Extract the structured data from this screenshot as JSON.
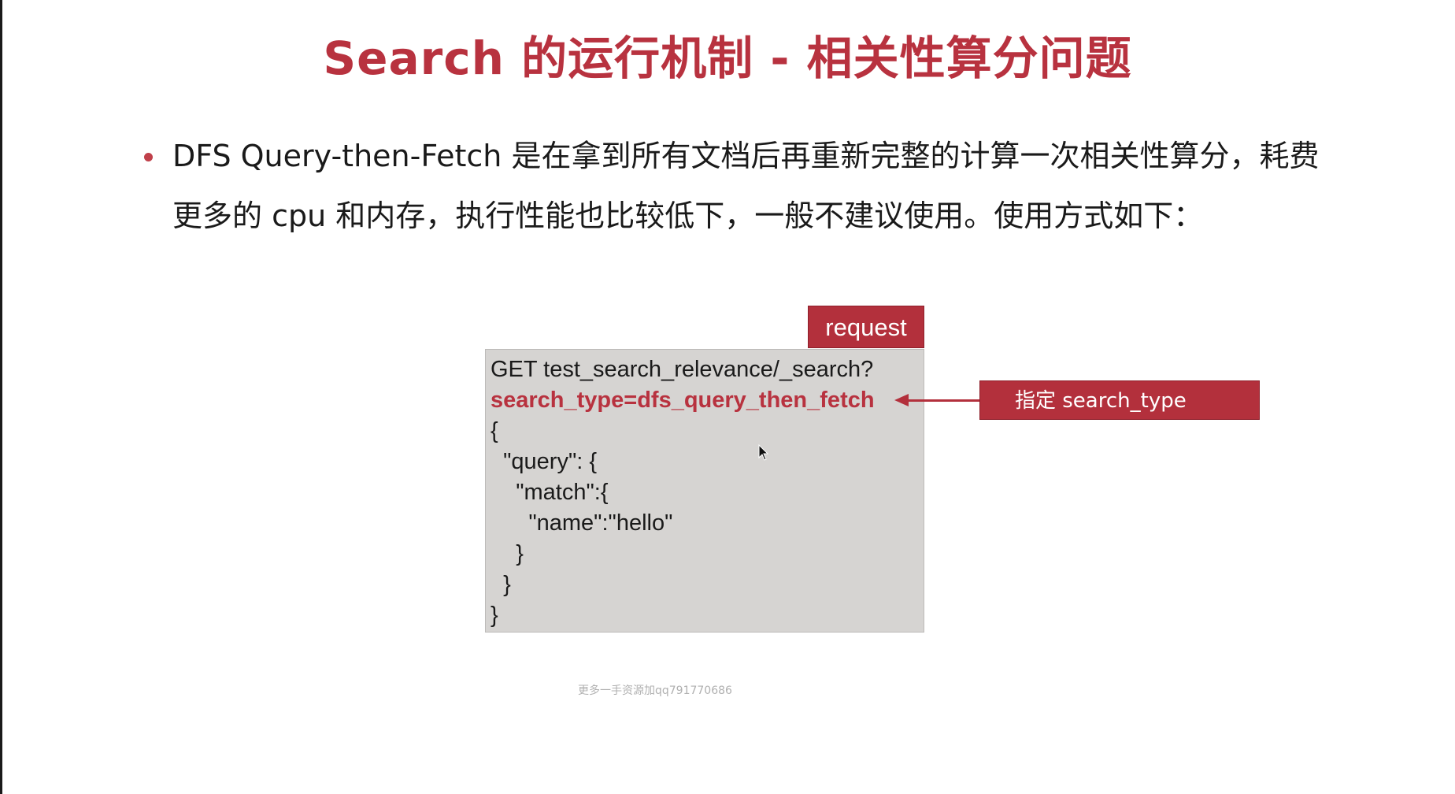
{
  "slide": {
    "title": "Search 的运行机制 - 相关性算分问题",
    "bullet_text": "DFS Query-then-Fetch 是在拿到所有文档后再重新完整的计算一次相关性算分，耗费更多的 cpu 和内存，执行性能也比较低下，一般不建议使用。使用方式如下：",
    "accent_color": "#b8323f"
  },
  "request_label": "request",
  "code": {
    "lines": [
      "GET test_search_relevance/_search?",
      "search_type=dfs_query_then_fetch",
      "{",
      "  \"query\": {",
      "    \"match\":{",
      "      \"name\":\"hello\"",
      "    }",
      "  }",
      "}"
    ],
    "highlighted_line": 1,
    "background_color": "#d6d4d2"
  },
  "annotation": {
    "label": "指定 search_type"
  },
  "watermark": "更多一手资源加qq791770686",
  "icons": {
    "cursor": "mouse-pointer-icon",
    "arrow": "arrow-left-icon",
    "bullet": "bullet-dot-icon"
  }
}
